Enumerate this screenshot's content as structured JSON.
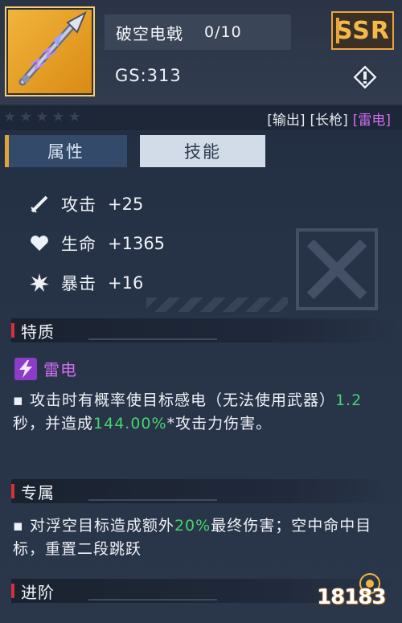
{
  "item": {
    "name": "破空电戟",
    "count": "0/10",
    "gs": "GS:313",
    "rarity": "SSR",
    "tags": [
      "[输出]",
      "[长枪]",
      "[雷电]"
    ],
    "stars_filled": 0,
    "stars_total": 5
  },
  "tabs": [
    {
      "label": "属性",
      "active": false
    },
    {
      "label": "技能",
      "active": true
    }
  ],
  "stats": [
    {
      "icon": "sword-icon",
      "name": "攻击",
      "value": "+25"
    },
    {
      "icon": "heart-icon",
      "name": "生命",
      "value": "+1365"
    },
    {
      "icon": "burst-icon",
      "name": "暴击",
      "value": "+16"
    }
  ],
  "sections": {
    "trait": {
      "title": "特质",
      "element_icon": "lightning-icon",
      "element_label": "雷电",
      "desc_pre": "攻击时有概率使目标感电（无法使用武器）",
      "desc_val1": "1.2",
      "desc_mid": "秒，并造成",
      "desc_val2": "144.00%",
      "desc_post": "*攻击力伤害。",
      "bullet": "▪"
    },
    "exclusive": {
      "title": "专属",
      "desc_pre": "对浮空目标造成额外",
      "desc_val": "20%",
      "desc_post": "最终伤害；空中命中目标，重置二段跳跃",
      "bullet": "▪"
    },
    "advance": {
      "title": "进阶"
    }
  },
  "watermark": {
    "text": "18183"
  },
  "colors": {
    "accent_gold": "#e9a43a",
    "element_purple": "#cf6df2",
    "highlight_green": "#46d56a",
    "section_red": "#d8303a"
  }
}
